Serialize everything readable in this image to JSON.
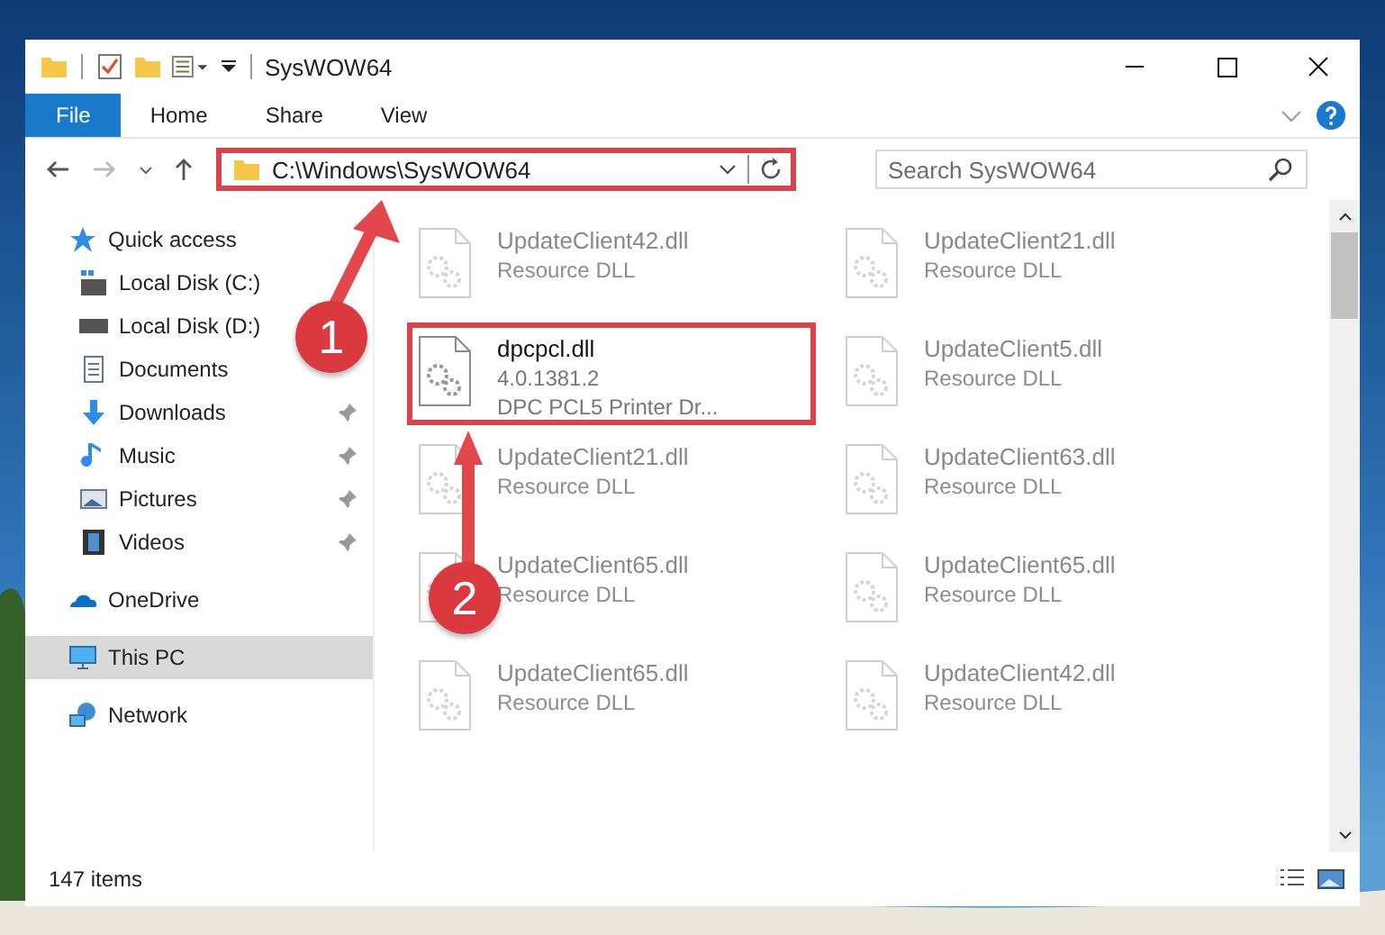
{
  "window": {
    "title": "SysWOW64"
  },
  "ribbon_tabs": [
    {
      "label": "File",
      "selected": true
    },
    {
      "label": "Home",
      "selected": false
    },
    {
      "label": "Share",
      "selected": false
    },
    {
      "label": "View",
      "selected": false
    }
  ],
  "address": {
    "path": "C:\\Windows\\SysWOW64",
    "highlighted": true
  },
  "search": {
    "placeholder": "Search SysWOW64"
  },
  "sidebar": {
    "items": [
      {
        "label": "Quick access",
        "kind": "star",
        "selected": false,
        "children": [
          {
            "label": "Local Disk (C:)",
            "kind": "disk-c",
            "pinned": false,
            "selected": false
          },
          {
            "label": "Local Disk (D:)",
            "kind": "disk",
            "pinned": false,
            "selected": false
          },
          {
            "label": "Documents",
            "kind": "docs",
            "pinned": false,
            "selected": false
          },
          {
            "label": "Downloads",
            "kind": "down",
            "pinned": true,
            "selected": false
          },
          {
            "label": "Music",
            "kind": "music",
            "pinned": true,
            "selected": false
          },
          {
            "label": "Pictures",
            "kind": "pics",
            "pinned": true,
            "selected": false
          },
          {
            "label": "Videos",
            "kind": "video",
            "pinned": true,
            "selected": false
          }
        ]
      },
      {
        "label": "OneDrive",
        "kind": "cloud",
        "selected": false
      },
      {
        "label": "This PC",
        "kind": "pc",
        "selected": true
      },
      {
        "label": "Network",
        "kind": "net",
        "selected": false
      }
    ]
  },
  "files": [
    {
      "name": "UpdateClient42.dll",
      "lines": [
        "Resource DLL"
      ],
      "dimmed": true,
      "highlighted": false
    },
    {
      "name": "UpdateClient21.dll",
      "lines": [
        "Resource DLL"
      ],
      "dimmed": true,
      "highlighted": false
    },
    {
      "name": "dpcpcl.dll",
      "lines": [
        "4.0.1381.2",
        "DPC PCL5 Printer Dr..."
      ],
      "dimmed": false,
      "highlighted": true
    },
    {
      "name": "UpdateClient5.dll",
      "lines": [
        "Resource DLL"
      ],
      "dimmed": true,
      "highlighted": false
    },
    {
      "name": "UpdateClient21.dll",
      "lines": [
        "Resource DLL"
      ],
      "dimmed": true,
      "highlighted": false
    },
    {
      "name": "UpdateClient63.dll",
      "lines": [
        "Resource DLL"
      ],
      "dimmed": true,
      "highlighted": false
    },
    {
      "name": "UpdateClient65.dll",
      "lines": [
        "Resource DLL"
      ],
      "dimmed": true,
      "highlighted": false
    },
    {
      "name": "UpdateClient65.dll",
      "lines": [
        "Resource DLL"
      ],
      "dimmed": true,
      "highlighted": false
    },
    {
      "name": "UpdateClient65.dll",
      "lines": [
        "Resource DLL"
      ],
      "dimmed": true,
      "highlighted": false
    },
    {
      "name": "UpdateClient42.dll",
      "lines": [
        "Resource DLL"
      ],
      "dimmed": true,
      "highlighted": false
    }
  ],
  "status_bar": {
    "count": "147 items"
  },
  "callouts": [
    {
      "number": "1"
    },
    {
      "number": "2"
    }
  ]
}
